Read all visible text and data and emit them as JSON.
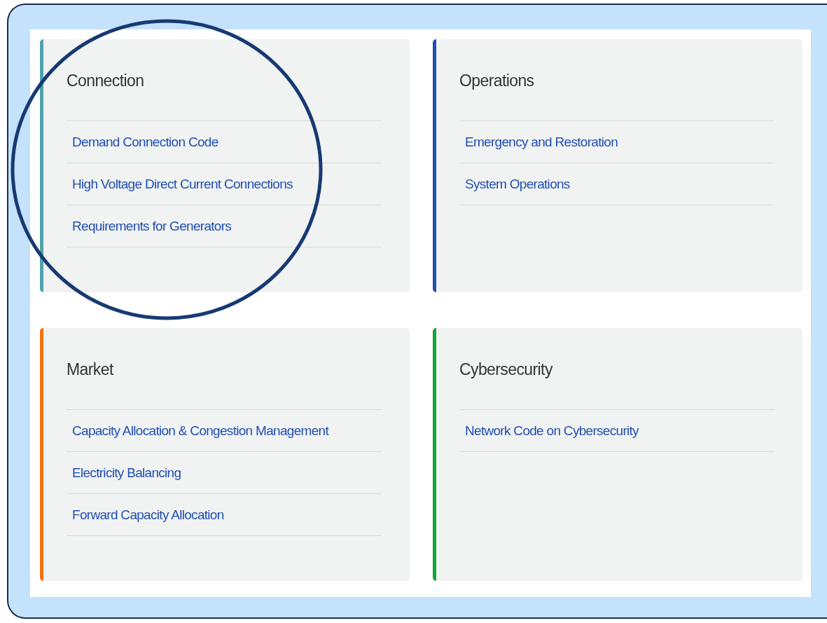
{
  "cards": [
    {
      "title": "Connection",
      "color": "#4fa3ab",
      "circled": true,
      "links": [
        "Demand Connection Code",
        "High Voltage Direct Current Connections",
        "Requirements for Generators"
      ]
    },
    {
      "title": "Operations",
      "color": "#1e4fb3",
      "circled": false,
      "links": [
        "Emergency and Restoration",
        "System Operations"
      ]
    },
    {
      "title": "Market",
      "color": "#f5700f",
      "circled": false,
      "links": [
        "Capacity Allocation & Congestion Management",
        "Electricity Balancing",
        "Forward Capacity Allocation"
      ]
    },
    {
      "title": "Cybersecurity",
      "color": "#10a83c",
      "circled": false,
      "links": [
        "Network Code on Cybersecurity"
      ]
    }
  ]
}
